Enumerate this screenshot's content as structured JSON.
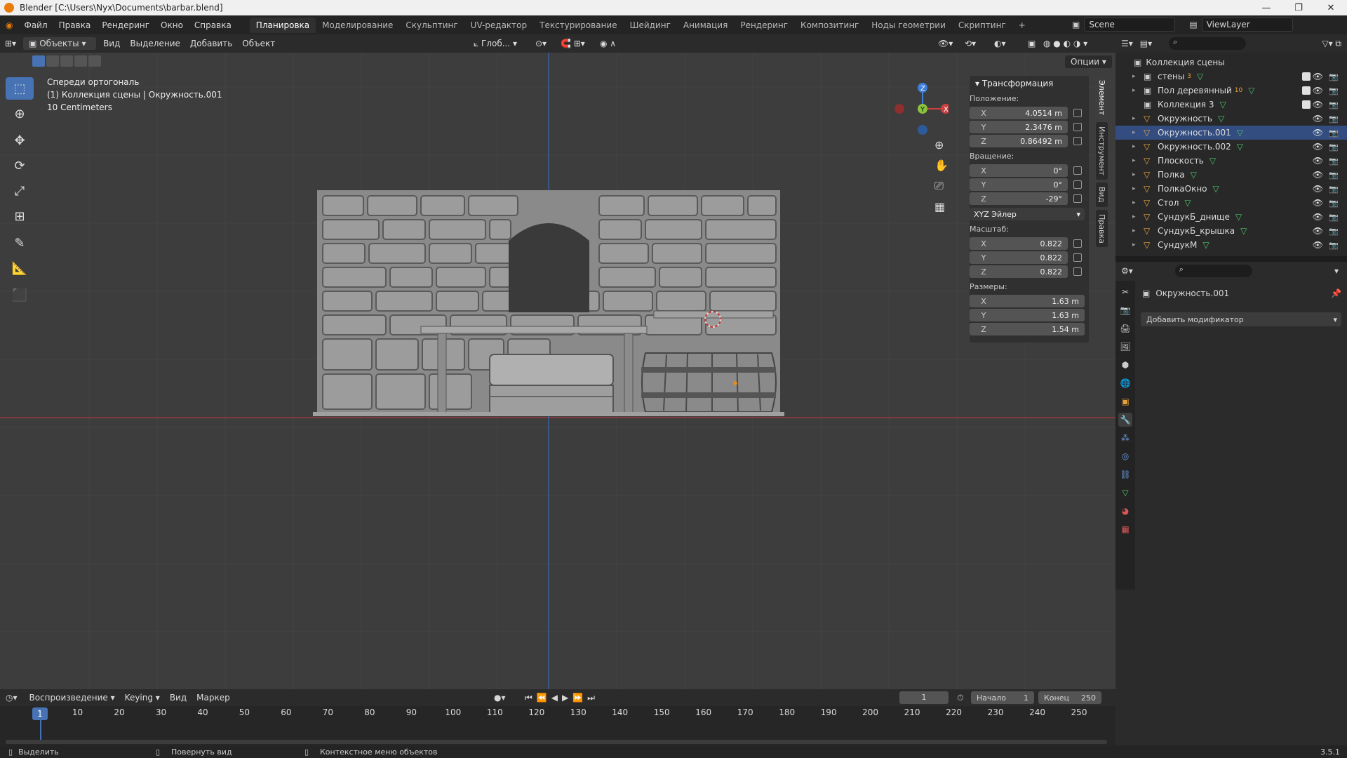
{
  "window": {
    "title": "Blender [C:\\Users\\Nyx\\Documents\\barbar.blend]"
  },
  "menu": [
    "Файл",
    "Правка",
    "Рендеринг",
    "Окно",
    "Справка"
  ],
  "workspaces": [
    "Планировка",
    "Моделирование",
    "Скульптинг",
    "UV-редактор",
    "Текстурирование",
    "Шейдинг",
    "Анимация",
    "Рендеринг",
    "Композитинг",
    "Ноды геометрии",
    "Скриптинг"
  ],
  "active_workspace": "Планировка",
  "scene": {
    "name": "Scene",
    "view_layer": "ViewLayer"
  },
  "viewport_header": {
    "mode": "Объекты",
    "menus": [
      "Вид",
      "Выделение",
      "Добавить",
      "Объект"
    ],
    "orientation": "Глоб...",
    "options": "Опции"
  },
  "viewport": {
    "view_name": "Спереди ортогональ",
    "collection_info": "(1) Коллекция сцены | Окружность.001",
    "scale_text": "10 Centimeters"
  },
  "npanel": {
    "section": "Трансформация",
    "location_label": "Положение:",
    "location": {
      "x": "4.0514 m",
      "y": "2.3476 m",
      "z": "0.86492 m"
    },
    "rotation_label": "Вращение:",
    "rotation": {
      "x": "0°",
      "y": "0°",
      "z": "-29°"
    },
    "rotation_mode": "XYZ Эйлер",
    "scale_label": "Масштаб:",
    "scale": {
      "x": "0.822",
      "y": "0.822",
      "z": "0.822"
    },
    "dimensions_label": "Размеры:",
    "dimensions": {
      "x": "1.63 m",
      "y": "1.63 m",
      "z": "1.54 m"
    },
    "tabs": [
      "Элемент",
      "Инструмент",
      "Вид",
      "Правка"
    ]
  },
  "outliner": {
    "root": "Коллекция сцены",
    "items": [
      {
        "name": "стены",
        "badge": "3"
      },
      {
        "name": "Пол деревянный",
        "badge": "10"
      },
      {
        "name": "Коллекция 3",
        "badge": ""
      },
      {
        "name": "Окружность",
        "badge": ""
      },
      {
        "name": "Окружность.001",
        "badge": ""
      },
      {
        "name": "Окружность.002",
        "badge": ""
      },
      {
        "name": "Плоскость",
        "badge": ""
      },
      {
        "name": "Полка",
        "badge": ""
      },
      {
        "name": "ПолкаОкно",
        "badge": ""
      },
      {
        "name": "Стол",
        "badge": ""
      },
      {
        "name": "СундукБ_днище",
        "badge": ""
      },
      {
        "name": "СундукБ_крышка",
        "badge": ""
      },
      {
        "name": "СундукМ",
        "badge": ""
      }
    ]
  },
  "properties": {
    "object_name": "Окружность.001",
    "add_modifier": "Добавить модификатор"
  },
  "timeline": {
    "menus": [
      "Воспроизведение",
      "Keying",
      "Вид",
      "Маркер"
    ],
    "current_frame": "1",
    "start_label": "Начало",
    "start": "1",
    "end_label": "Конец",
    "end": "250",
    "ticks": [
      "1",
      "10",
      "20",
      "30",
      "40",
      "50",
      "60",
      "70",
      "80",
      "90",
      "100",
      "110",
      "120",
      "130",
      "140",
      "150",
      "160",
      "170",
      "180",
      "190",
      "200",
      "210",
      "220",
      "230",
      "240",
      "250"
    ]
  },
  "statusbar": {
    "select": "Выделить",
    "rotate": "Повернуть вид",
    "context": "Контекстное меню объектов",
    "version": "3.5.1"
  },
  "colors": {
    "accent": "#4772b3",
    "axis_x": "#d04040",
    "axis_y": "#8ac43a",
    "axis_z": "#3f7fd8",
    "mesh_icon": "#e9a23b"
  }
}
